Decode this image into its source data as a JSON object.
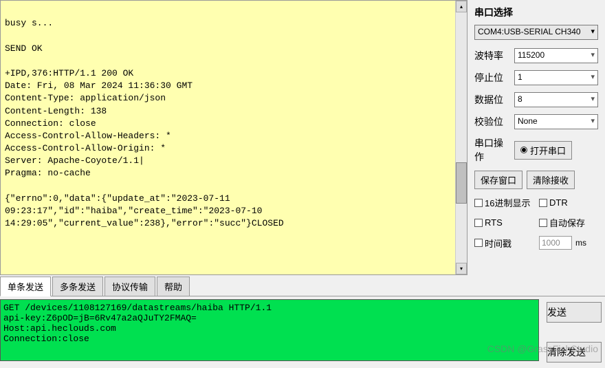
{
  "output_text": "\nbusy s...\n\nSEND OK\n\n+IPD,376:HTTP/1.1 200 OK\nDate: Fri, 08 Mar 2024 11:36:30 GMT\nContent-Type: application/json\nContent-Length: 138\nConnection: close\nAccess-Control-Allow-Headers: *\nAccess-Control-Allow-Origin: *\nServer: Apache-Coyote/1.1|\nPragma: no-cache\n\n{\"errno\":0,\"data\":{\"update_at\":\"2023-07-11 09:23:17\",\"id\":\"haiba\",\"create_time\":\"2023-07-10 14:29:05\",\"current_value\":238},\"error\":\"succ\"}CLOSED",
  "right": {
    "port_section": "串口选择",
    "port_value": "COM4:USB-SERIAL CH340",
    "params": {
      "baud_label": "波特率",
      "baud_value": "115200",
      "stop_label": "停止位",
      "stop_value": "1",
      "data_label": "数据位",
      "data_value": "8",
      "parity_label": "校验位",
      "parity_value": "None",
      "op_label": "串口操作",
      "op_button": "打开串口"
    },
    "buttons": {
      "save_window": "保存窗口",
      "clear_recv": "清除接收"
    },
    "checks": {
      "hex_display": "16进制显示",
      "dtr": "DTR",
      "rts": "RTS",
      "autosave": "自动保存",
      "timestamp": "时间戳",
      "time_value": "1000",
      "ms": "ms"
    }
  },
  "tabs": {
    "single": "单条发送",
    "multi": "多条发送",
    "protocol": "协议传输",
    "help": "帮助"
  },
  "input_text": "GET /devices/1108127169/datastreams/haiba HTTP/1.1\napi-key:Z6pOD=jB=6Rv47a2aQJuTY2FMAQ=\nHost:api.heclouds.com\nConnection:close",
  "send_panel": {
    "send": "发送",
    "clear_send": "清除发送"
  },
  "watermark": "CSDN @GrassFishStudio"
}
